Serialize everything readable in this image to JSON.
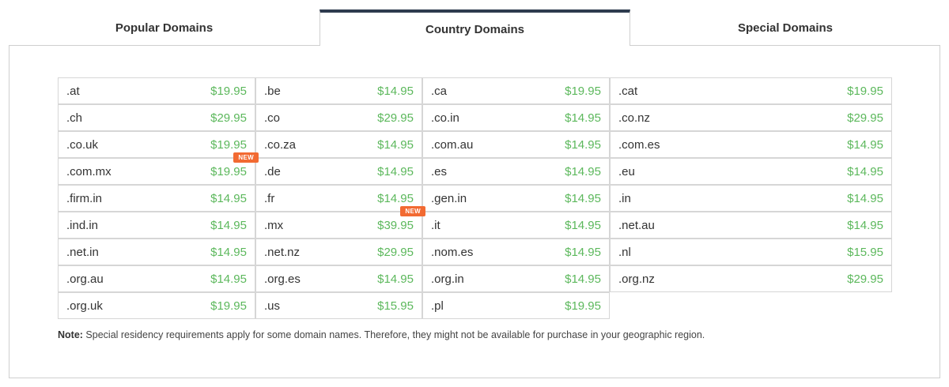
{
  "tabs": {
    "popular": "Popular Domains",
    "country": "Country Domains",
    "special": "Special Domains"
  },
  "badge_label": "NEW",
  "columns": [
    [
      {
        "domain": ".at",
        "price": "$19.95"
      },
      {
        "domain": ".ch",
        "price": "$29.95"
      },
      {
        "domain": ".co.uk",
        "price": "$19.95"
      },
      {
        "domain": ".com.mx",
        "price": "$19.95",
        "badge": true
      },
      {
        "domain": ".firm.in",
        "price": "$14.95"
      },
      {
        "domain": ".ind.in",
        "price": "$14.95"
      },
      {
        "domain": ".net.in",
        "price": "$14.95"
      },
      {
        "domain": ".org.au",
        "price": "$14.95"
      },
      {
        "domain": ".org.uk",
        "price": "$19.95"
      }
    ],
    [
      {
        "domain": ".be",
        "price": "$14.95"
      },
      {
        "domain": ".co",
        "price": "$29.95"
      },
      {
        "domain": ".co.za",
        "price": "$14.95"
      },
      {
        "domain": ".de",
        "price": "$14.95"
      },
      {
        "domain": ".fr",
        "price": "$14.95"
      },
      {
        "domain": ".mx",
        "price": "$39.95",
        "badge": true
      },
      {
        "domain": ".net.nz",
        "price": "$29.95"
      },
      {
        "domain": ".org.es",
        "price": "$14.95"
      },
      {
        "domain": ".us",
        "price": "$15.95"
      }
    ],
    [
      {
        "domain": ".ca",
        "price": "$19.95"
      },
      {
        "domain": ".co.in",
        "price": "$14.95"
      },
      {
        "domain": ".com.au",
        "price": "$14.95"
      },
      {
        "domain": ".es",
        "price": "$14.95"
      },
      {
        "domain": ".gen.in",
        "price": "$14.95"
      },
      {
        "domain": ".it",
        "price": "$14.95"
      },
      {
        "domain": ".nom.es",
        "price": "$14.95"
      },
      {
        "domain": ".org.in",
        "price": "$14.95"
      },
      {
        "domain": ".pl",
        "price": "$19.95"
      }
    ],
    [
      {
        "domain": ".cat",
        "price": "$19.95"
      },
      {
        "domain": ".co.nz",
        "price": "$29.95"
      },
      {
        "domain": ".com.es",
        "price": "$14.95"
      },
      {
        "domain": ".eu",
        "price": "$14.95"
      },
      {
        "domain": ".in",
        "price": "$14.95"
      },
      {
        "domain": ".net.au",
        "price": "$14.95"
      },
      {
        "domain": ".nl",
        "price": "$15.95"
      },
      {
        "domain": ".org.nz",
        "price": "$29.95"
      }
    ]
  ],
  "note": {
    "label": "Note:",
    "text": " Special residency requirements apply for some domain names. Therefore, they might not be available for purchase in your geographic region."
  },
  "colors": {
    "price": "#5cb85c",
    "badge": "#f26a32",
    "active_tab_bar": "#2e3b4e"
  }
}
